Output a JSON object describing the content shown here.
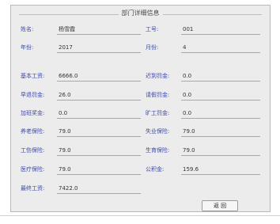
{
  "dialog": {
    "group_title": "部门详细信息"
  },
  "fields": {
    "name": {
      "label": "姓名:",
      "value": "杨雪霞"
    },
    "employee_id": {
      "label": "工号:",
      "value": "001"
    },
    "year": {
      "label": "年份:",
      "value": "2017"
    },
    "month": {
      "label": "月份:",
      "value": "4"
    },
    "basic_salary": {
      "label": "基本工资:",
      "value": "6666.0"
    },
    "late_penalty": {
      "label": "迟到罚金:",
      "value": "0.0"
    },
    "early_leave_penalty": {
      "label": "早退罚金:",
      "value": "26.0"
    },
    "leave_penalty": {
      "label": "请假罚金:",
      "value": "0.0"
    },
    "overtime_bonus": {
      "label": "加班奖金:",
      "value": "0.0"
    },
    "absence_penalty": {
      "label": "旷工罚金:",
      "value": "0.0"
    },
    "pension_insurance": {
      "label": "养老保险:",
      "value": "79.0"
    },
    "unemployment_insurance": {
      "label": "失业保险:",
      "value": "79.0"
    },
    "work_injury_insurance": {
      "label": "工伤保险:",
      "value": "79.0"
    },
    "maternity_insurance": {
      "label": "生育保险:",
      "value": "79.0"
    },
    "medical_insurance": {
      "label": "医疗保险:",
      "value": "79.0"
    },
    "housing_fund": {
      "label": "公积金:",
      "value": "159.6"
    },
    "final_salary": {
      "label": "最终工资:",
      "value": "7422.0"
    }
  },
  "buttons": {
    "back_label": "返 回"
  }
}
